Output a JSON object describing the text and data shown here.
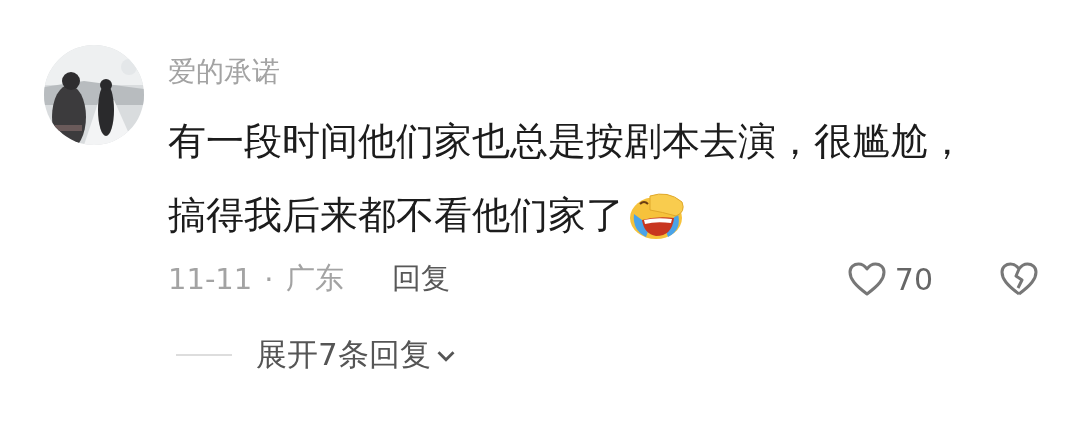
{
  "comment": {
    "username": "爱的承诺",
    "text_lines": [
      "有一段时间他们家也总是按剧本去演，很尴尬，",
      "搞得我后来都不看他们家了"
    ],
    "date": "11-11",
    "separator": "·",
    "location": "广东",
    "reply_label": "回复",
    "like_count": "70",
    "liked": false,
    "disliked": false,
    "expand_replies": "展开7条回复",
    "expanded": false
  }
}
